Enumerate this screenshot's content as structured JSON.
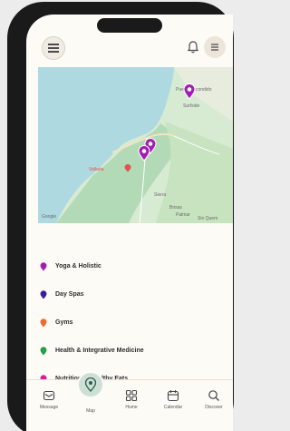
{
  "header": {
    "menu_icon": "hamburger-icon",
    "bell_icon": "bell-icon",
    "chat_icon": "chat-icon"
  },
  "map": {
    "labels": {
      "top_town": "Puerto Escondido",
      "top_town_2": "Surfside",
      "city": "Vallarta",
      "area_1": "Sierra",
      "area_2": "Brisas",
      "area_3": "Palmar",
      "area_4": "Sin Quem"
    },
    "attribution": "Google",
    "pin_color": "#a11fb0"
  },
  "categories": [
    {
      "label": "Yoga & Holistic",
      "color": "#a11fb0"
    },
    {
      "label": "Day Spas",
      "color": "#3b1e9e"
    },
    {
      "label": "Gyms",
      "color": "#ef6c2e"
    },
    {
      "label": "Health & Integrative Medicine",
      "color": "#22a04a"
    },
    {
      "label": "Nutrition & Healthy Eats",
      "color": "#d81b9c"
    }
  ],
  "nav": {
    "items": [
      {
        "label": "Message",
        "icon": "message-icon"
      },
      {
        "label": "Map",
        "icon": "map-pin-icon"
      },
      {
        "label": "Home",
        "icon": "grid-icon"
      },
      {
        "label": "Calendar",
        "icon": "calendar-icon"
      },
      {
        "label": "Discover",
        "icon": "search-icon"
      }
    ]
  }
}
